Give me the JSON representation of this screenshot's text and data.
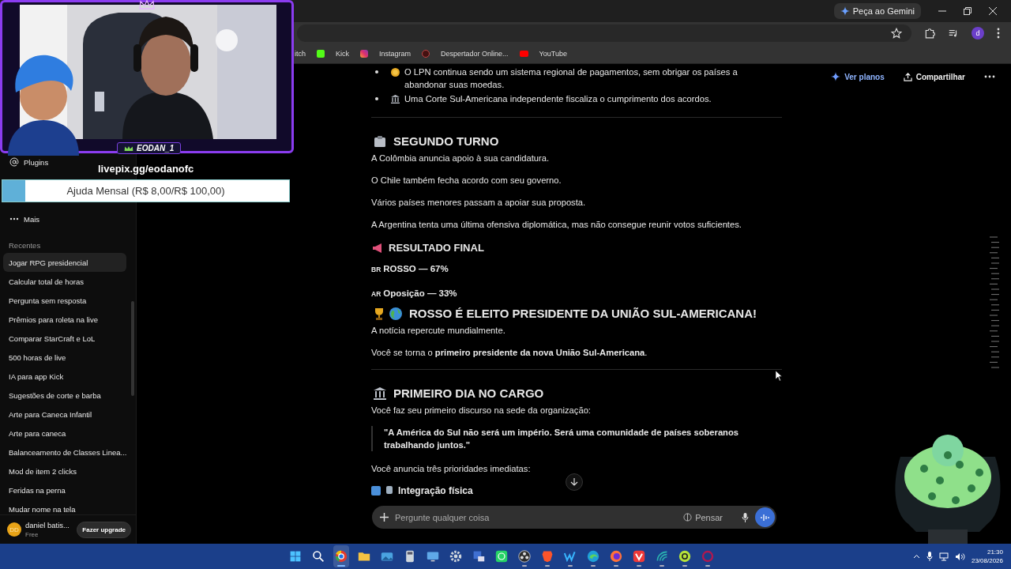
{
  "browser": {
    "gemini_button": "Peça ao Gemini",
    "profile_initial": "d",
    "bookmarks": [
      {
        "label": "itch"
      },
      {
        "label": "Kick"
      },
      {
        "label": "Instagram"
      },
      {
        "label": "Despertador Online..."
      },
      {
        "label": "YouTube"
      }
    ]
  },
  "sidebar": {
    "items": [
      {
        "label": "Plugins"
      },
      {
        "label": "Mais"
      }
    ],
    "recent_heading": "Recentes",
    "recents": [
      {
        "label": "Jogar RPG presidencial",
        "selected": true
      },
      {
        "label": "Calcular total de horas",
        "selected": false
      },
      {
        "label": "Pergunta sem resposta",
        "selected": false
      },
      {
        "label": "Prêmios para roleta na live",
        "selected": false
      },
      {
        "label": "Comparar StarCraft e LoL",
        "selected": false
      },
      {
        "label": "500 horas de live",
        "selected": false
      },
      {
        "label": "IA para app Kick",
        "selected": false
      },
      {
        "label": "Sugestões de corte e barba",
        "selected": false
      },
      {
        "label": "Arte para Caneca Infantil",
        "selected": false
      },
      {
        "label": "Arte para caneca",
        "selected": false
      },
      {
        "label": "Balanceamento de Classes Linea...",
        "selected": false
      },
      {
        "label": "Mod de item 2 clicks",
        "selected": false
      },
      {
        "label": "Feridas na perna",
        "selected": false
      },
      {
        "label": "Mudar nome na tela",
        "selected": false
      }
    ],
    "user": {
      "initials": "DD",
      "name": "daniel batis...",
      "plan": "Free"
    },
    "upgrade_button": "Fazer upgrade"
  },
  "header": {
    "plans_button": "Ver planos",
    "share_button": "Compartilhar"
  },
  "content": [
    {
      "kind": "bullet",
      "text": "O LPN continua sendo um sistema regional de pagamentos, sem obrigar os países a abandonar suas moedas."
    },
    {
      "kind": "bullet",
      "text": "Uma Corte Sul-Americana independente fiscaliza o cumprimento dos acordos."
    },
    {
      "kind": "rule"
    },
    {
      "kind": "heading",
      "text": "SEGUNDO TURNO"
    },
    {
      "kind": "paragraph",
      "text": "A Colômbia anuncia apoio à sua candidatura."
    },
    {
      "kind": "paragraph",
      "text": "O Chile também fecha acordo com seu governo."
    },
    {
      "kind": "paragraph",
      "text": "Vários países menores passam a apoiar sua proposta."
    },
    {
      "kind": "paragraph",
      "text": "A Argentina tenta uma última ofensiva diplomática, mas não consegue reunir votos suficientes."
    },
    {
      "kind": "subheading",
      "text": "RESULTADO FINAL"
    },
    {
      "kind": "result",
      "flag": "BR",
      "text": "ROSSO — 67%"
    },
    {
      "kind": "result",
      "flag": "AR",
      "text": "Oposição — 33%"
    },
    {
      "kind": "heading",
      "text": "ROSSO É ELEITO PRESIDENTE DA UNIÃO SUL-AMERICANA!"
    },
    {
      "kind": "paragraph",
      "text": "A notícia repercute mundialmente."
    },
    {
      "kind": "paragraph",
      "text": "Você se torna o **primeiro presidente da nova União Sul-Americana**."
    },
    {
      "kind": "rule"
    },
    {
      "kind": "heading",
      "text": "PRIMEIRO DIA NO CARGO"
    },
    {
      "kind": "paragraph",
      "text": "Você faz seu primeiro discurso na sede da organização:"
    },
    {
      "kind": "quote",
      "text": "\"A América do Sul não será um império. Será uma comunidade de países soberanos trabalhando juntos.\""
    },
    {
      "kind": "paragraph",
      "text": "Você anuncia três prioridades imediatas:"
    },
    {
      "kind": "item",
      "text": "Integração física"
    }
  ],
  "composer": {
    "placeholder": "Pergunte qualquer coisa",
    "think_button": "Pensar"
  },
  "overlay": {
    "streamer_name": "EODAN_1",
    "donation_link": "livepix.gg/eodanofc",
    "goal_text": "Ajuda Mensal (R$ 8,00/R$ 100,00)",
    "level": 0.08
  },
  "taskbar": {
    "apps": [
      {
        "open": false,
        "selected": false
      },
      {
        "open": false,
        "selected": false
      },
      {
        "open": true,
        "selected": true
      },
      {
        "open": false,
        "selected": false
      },
      {
        "open": false,
        "selected": false
      },
      {
        "open": false,
        "selected": false
      },
      {
        "open": false,
        "selected": false
      },
      {
        "open": false,
        "selected": false
      },
      {
        "open": false,
        "selected": false
      },
      {
        "open": false,
        "selected": false
      },
      {
        "open": true,
        "selected": false
      },
      {
        "open": true,
        "selected": false
      },
      {
        "open": true,
        "selected": false
      },
      {
        "open": true,
        "selected": false
      },
      {
        "open": true,
        "selected": false
      },
      {
        "open": true,
        "selected": false
      },
      {
        "open": true,
        "selected": false
      },
      {
        "open": true,
        "selected": false
      },
      {
        "open": true,
        "selected": false
      }
    ],
    "time": "21:30",
    "date": "23/08/2026"
  }
}
